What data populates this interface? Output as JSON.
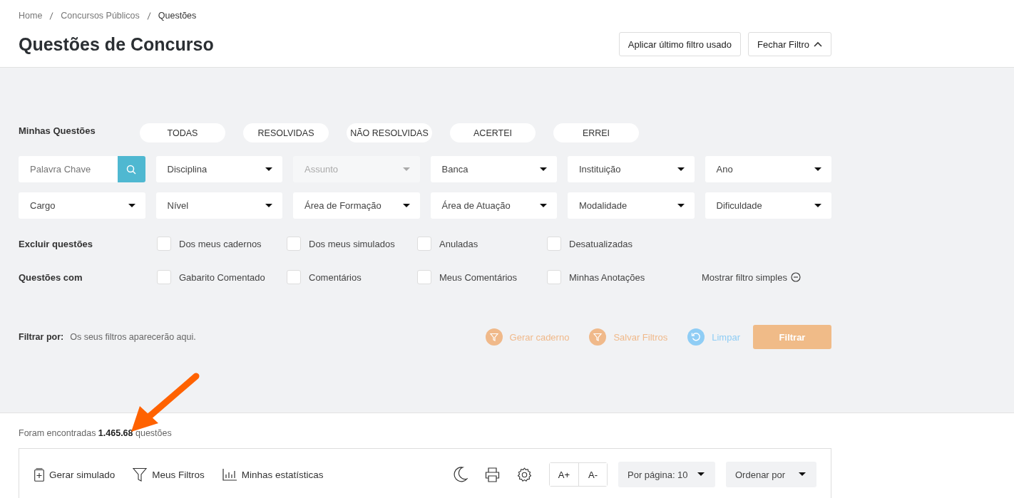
{
  "breadcrumb": [
    {
      "label": "Home",
      "current": false
    },
    {
      "label": "Concursos Públicos",
      "current": false
    },
    {
      "label": "Questões",
      "current": true
    }
  ],
  "title": "Questões de Concurso",
  "header_buttons": [
    {
      "label": "Aplicar último filtro usado",
      "kind": "plain"
    },
    {
      "label": "Fechar Filtro",
      "kind": "collapse"
    }
  ],
  "my_questions": {
    "label": "Minhas Questões",
    "options": [
      {
        "label": "TODAS",
        "selected": false
      },
      {
        "label": "RESOLVIDAS",
        "selected": false
      },
      {
        "label": "NÃO RESOLVIDAS",
        "selected": false
      },
      {
        "label": "ACERTEI",
        "selected": false
      },
      {
        "label": "ERREI",
        "selected": false
      }
    ]
  },
  "keyword": {
    "placeholder": "Palavra Chave"
  },
  "dropdowns": [
    {
      "label": "Disciplina",
      "disabled": false
    },
    {
      "label": "Assunto",
      "disabled": true
    },
    {
      "label": "Banca",
      "disabled": false
    },
    {
      "label": "Instituição",
      "disabled": false
    },
    {
      "label": "Ano",
      "disabled": false
    },
    {
      "label": "Cargo",
      "disabled": false
    },
    {
      "label": "Nível",
      "disabled": false
    },
    {
      "label": "Área de Formação",
      "disabled": false
    },
    {
      "label": "Área de Atuação",
      "disabled": false
    },
    {
      "label": "Modalidade",
      "disabled": false
    },
    {
      "label": "Dificuldade",
      "disabled": false
    }
  ],
  "exclude": {
    "label": "Excluir questões",
    "options": [
      {
        "label": "Dos meus cadernos",
        "checked": false
      },
      {
        "label": "Dos meus simulados",
        "checked": false
      },
      {
        "label": "Anuladas",
        "checked": false
      },
      {
        "label": "Desatualizadas",
        "checked": false
      }
    ]
  },
  "with": {
    "label": "Questões com",
    "options": [
      {
        "label": "Gabarito Comentado",
        "checked": false
      },
      {
        "label": "Comentários",
        "checked": false
      },
      {
        "label": "Meus Comentários",
        "checked": false
      },
      {
        "label": "Minhas Anotações",
        "checked": false
      }
    ],
    "toggle": "Mostrar filtro simples"
  },
  "filter_by": {
    "label": "Filtrar por:",
    "text": "Os seus filtros aparecerão aqui."
  },
  "actions": [
    {
      "label": "Gerar caderno",
      "kind": "funnel",
      "color": "#f0b98a"
    },
    {
      "label": "Salvar Filtros",
      "kind": "funnel",
      "color": "#f0b98a"
    },
    {
      "label": "Limpar",
      "kind": "undo",
      "color": "#8fcdf5"
    }
  ],
  "submit": "Filtrar",
  "results": "Foram encontradas **1.465.68** questões",
  "toolbar": {
    "links": [
      {
        "label": "Gerar simulado",
        "kind": "simulado"
      },
      {
        "label": "Meus Filtros",
        "kind": "funnel"
      },
      {
        "label": "Minhas estatísticas",
        "kind": "chart"
      }
    ],
    "font_buttons": [
      "A+",
      "A-"
    ],
    "selects": [
      "Por página: 10",
      "Ordenar por"
    ]
  }
}
